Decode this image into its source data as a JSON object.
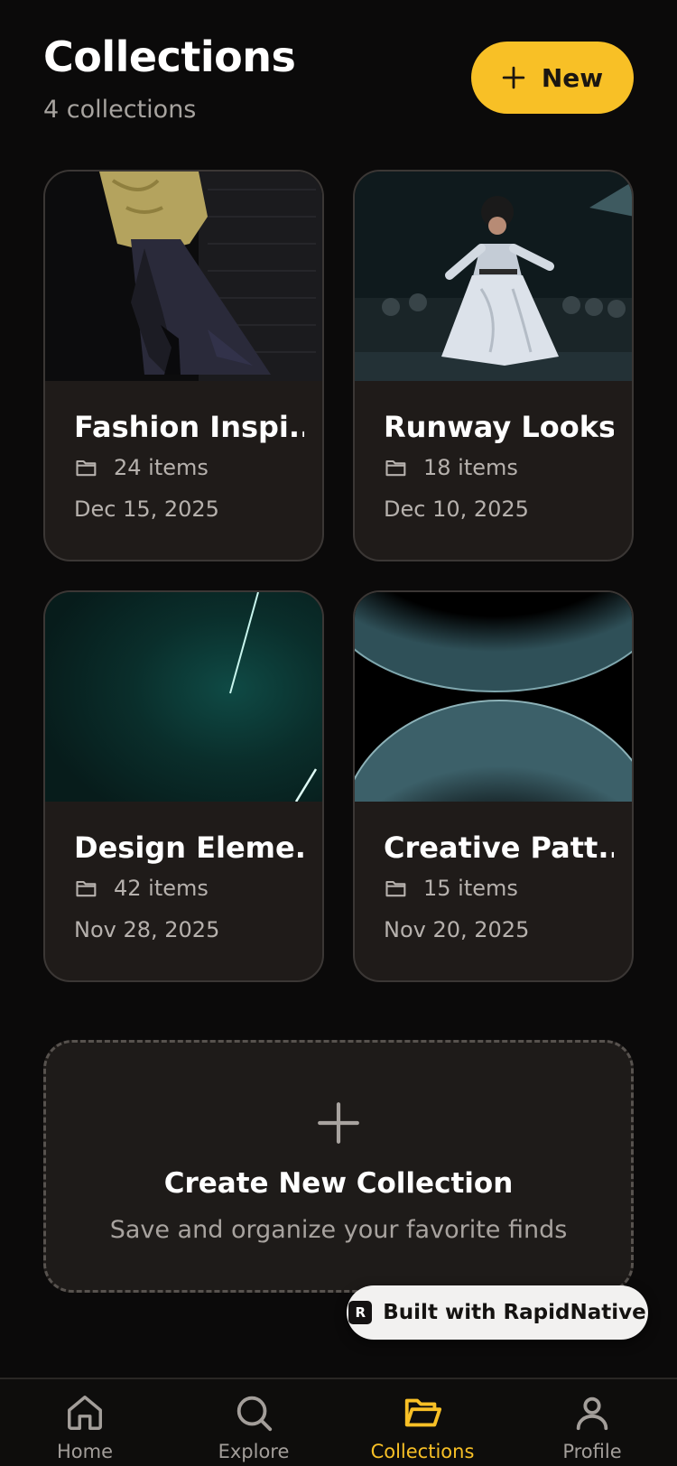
{
  "header": {
    "title": "Collections",
    "subtitle": "4 collections",
    "new_label": "New"
  },
  "collections": [
    {
      "title": "Fashion Inspi...",
      "items": "24 items",
      "date": "Dec 15, 2025",
      "image": "fashion-photo"
    },
    {
      "title": "Runway Looks",
      "items": "18 items",
      "date": "Dec 10, 2025",
      "image": "runway-photo"
    },
    {
      "title": "Design Eleme...",
      "items": "42 items",
      "date": "Nov 28, 2025",
      "image": "teal-light-abstract"
    },
    {
      "title": "Creative Patt...",
      "items": "15 items",
      "date": "Nov 20, 2025",
      "image": "curved-shapes-abstract"
    }
  ],
  "create": {
    "title": "Create New Collection",
    "subtitle": "Save and organize your favorite finds"
  },
  "badge": {
    "label": "Built with RapidNative"
  },
  "tabs": [
    {
      "label": "Home",
      "icon": "home-icon",
      "active": false
    },
    {
      "label": "Explore",
      "icon": "search-icon",
      "active": false
    },
    {
      "label": "Collections",
      "icon": "folder-open-icon",
      "active": true
    },
    {
      "label": "Profile",
      "icon": "user-icon",
      "active": false
    }
  ],
  "colors": {
    "accent": "#f8c026",
    "background": "#0b0a0a",
    "card": "#1f1b19"
  }
}
